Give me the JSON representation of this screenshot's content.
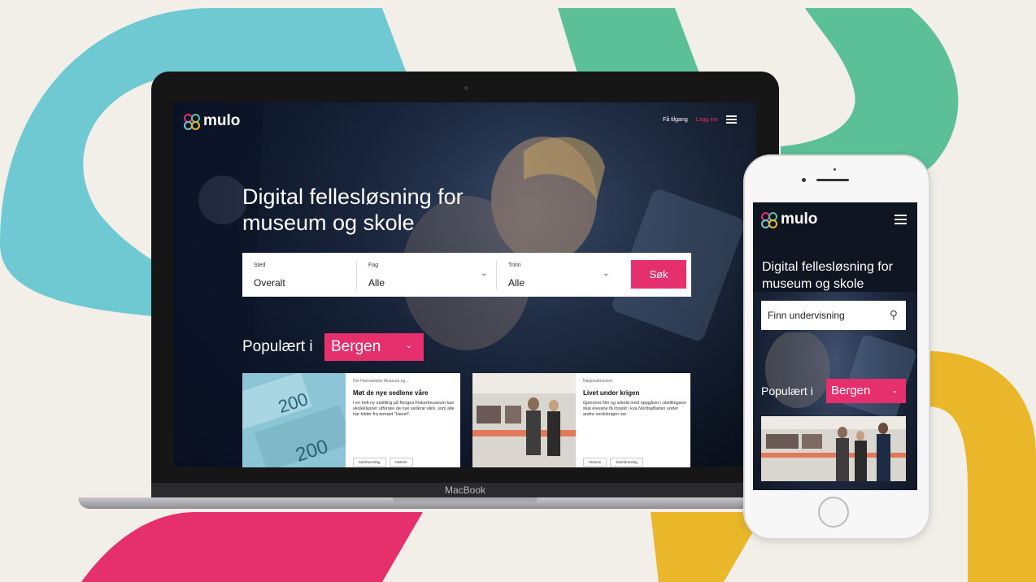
{
  "colors": {
    "accent": "#e6306e",
    "teal": "#6ec9d2",
    "green": "#5bbf9a",
    "yellow": "#eab72b",
    "pink": "#e6306e"
  },
  "laptop": {
    "brand_label": "MacBook",
    "site": {
      "logo": "mulo",
      "nav": {
        "access": "Få tilgang",
        "login": "Logg inn",
        "menu_icon": "hamburger-icon"
      },
      "hero_title_line1": "Digital fellesløsning for",
      "hero_title_line2": "museum og skole",
      "search": {
        "fields": [
          {
            "label": "Sted",
            "value": "Overalt"
          },
          {
            "label": "Fag",
            "value": "Alle"
          },
          {
            "label": "Trinn",
            "value": "Alle"
          }
        ],
        "button": "Søk"
      },
      "popular_label": "Populært i",
      "city": "Bergen",
      "cards": [
        {
          "source": "Det Hanseatiske Museum og ...",
          "title": "Møt de nye sedlene våre",
          "description": "I en helt ny utstilling på Norges Fiskerimuseum kan skoleklasser utforske de nye sedene våre, som alle har bilder fra temaet \"Havet\".",
          "tags": [
            "Samfunnsfag",
            "Historie"
          ]
        },
        {
          "source": "Nasjonalmuseet",
          "title": "Livet under krigen",
          "description": "Gjennom film og arbeid med oppgåver i utstillingane skal elevane få innsikt i kva Nordsjøfarten under andre verdskrigen var.",
          "tags": [
            "Historie",
            "Samfunnsfag"
          ]
        }
      ]
    }
  },
  "phone": {
    "logo": "mulo",
    "hero_title_line1": "Digital fellesløsning for",
    "hero_title_line2": "museum og skole",
    "search_placeholder": "Finn undervisning",
    "popular_label": "Populært i",
    "city": "Bergen"
  }
}
